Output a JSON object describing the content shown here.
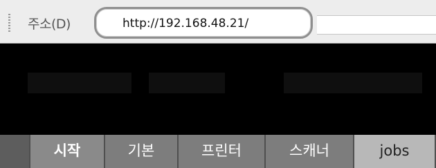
{
  "address_bar": {
    "label": "주소(D)",
    "url": "http://192.168.48.21/"
  },
  "nav": {
    "tabs": [
      {
        "label": "시작"
      },
      {
        "label": "기본"
      },
      {
        "label": "프린터"
      },
      {
        "label": "스캐너"
      },
      {
        "label": "jobs"
      }
    ]
  }
}
